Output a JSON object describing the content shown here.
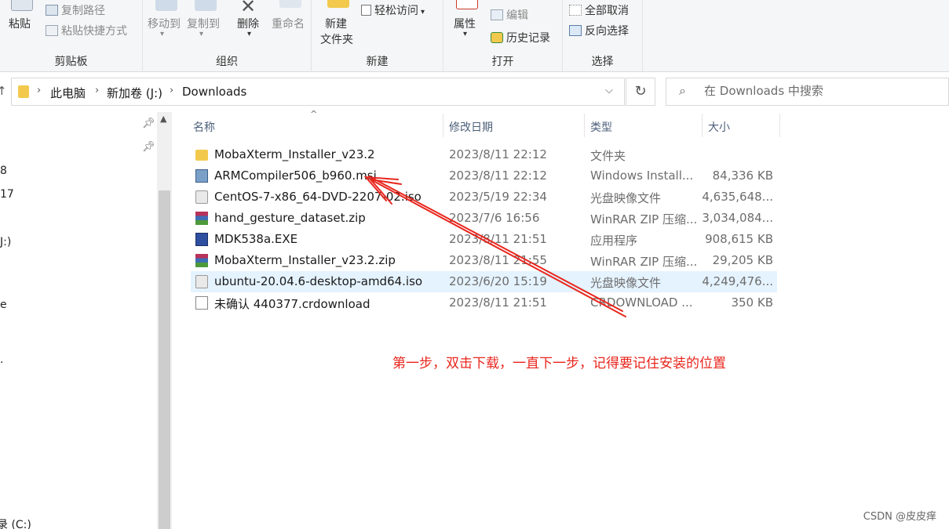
{
  "ribbon": {
    "clipboard": {
      "paste": "粘贴",
      "copy_path": "复制路径",
      "paste_shortcut": "粘贴快捷方式",
      "group": "剪贴板"
    },
    "organize": {
      "move_to": "移动到",
      "copy_to": "复制到",
      "delete": "删除",
      "rename": "重命名",
      "group": "组织"
    },
    "new": {
      "new_folder_line1": "新建",
      "new_folder_line2": "文件夹",
      "easy_access": "轻松访问",
      "group": "新建"
    },
    "open": {
      "properties": "属性",
      "edit": "编辑",
      "history": "历史记录",
      "group": "打开"
    },
    "select": {
      "select_none": "全部取消",
      "invert": "反向选择",
      "group": "选择"
    }
  },
  "address": {
    "crumbs": [
      "此电脑",
      "新加卷 (J:)",
      "Downloads"
    ],
    "search_placeholder": "在 Downloads 中搜索"
  },
  "nav": {
    "items": [
      "8",
      "17",
      "J:)",
      "e",
      ".",
      "录 (C:)"
    ]
  },
  "columns": {
    "name": "名称",
    "modified": "修改日期",
    "type": "类型",
    "size": "大小"
  },
  "files": [
    {
      "name": "MobaXterm_Installer_v23.2",
      "date": "2023/8/11 22:12",
      "type": "文件夹",
      "size": "",
      "icon": "folder-icon",
      "selected": false
    },
    {
      "name": "ARMCompiler506_b960.msi",
      "date": "2023/8/11 22:12",
      "type": "Windows Install...",
      "size": "84,336 KB",
      "icon": "msi-icon",
      "selected": false
    },
    {
      "name": "CentOS-7-x86_64-DVD-2207-02.iso",
      "date": "2023/5/19 22:34",
      "type": "光盘映像文件",
      "size": "4,635,648...",
      "icon": "disc-image-icon",
      "selected": false
    },
    {
      "name": "hand_gesture_dataset.zip",
      "date": "2023/7/6 16:56",
      "type": "WinRAR ZIP 压缩...",
      "size": "3,034,084...",
      "icon": "winrar-icon",
      "selected": false
    },
    {
      "name": "MDK538a.EXE",
      "date": "2023/8/11 21:51",
      "type": "应用程序",
      "size": "908,615 KB",
      "icon": "exe-icon",
      "selected": false
    },
    {
      "name": "MobaXterm_Installer_v23.2.zip",
      "date": "2023/8/11 21:55",
      "type": "WinRAR ZIP 压缩...",
      "size": "29,205 KB",
      "icon": "winrar-icon",
      "selected": false
    },
    {
      "name": "ubuntu-20.04.6-desktop-amd64.iso",
      "date": "2023/6/20 15:19",
      "type": "光盘映像文件",
      "size": "4,249,476...",
      "icon": "disc-image-icon",
      "selected": true
    },
    {
      "name": "未确认 440377.crdownload",
      "date": "2023/8/11 21:51",
      "type": "CRDOWNLOAD ...",
      "size": "350 KB",
      "icon": "blank-file-icon",
      "selected": false
    }
  ],
  "annotation": "第一步，双击下载，一直下一步，记得要记住安装的位置",
  "watermark": "CSDN @皮皮痒",
  "colors": {
    "annotation_red": "#e8261d",
    "selection": "#e5f3ff",
    "folder_yellow": "#f2c94c"
  }
}
